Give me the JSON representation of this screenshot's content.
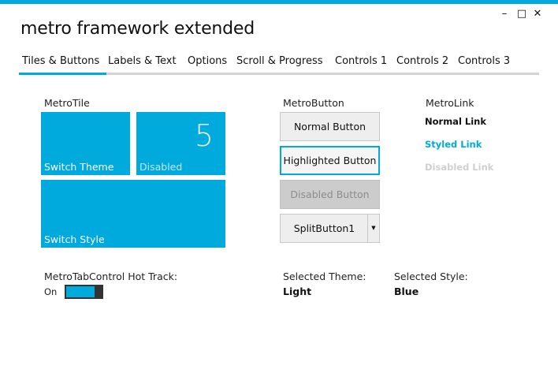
{
  "app": {
    "title": "metro framework extended"
  },
  "window_controls": {
    "minimize": "–",
    "maximize": "□",
    "close": "✕"
  },
  "tabs": [
    {
      "label": "Tiles & Buttons",
      "active": true
    },
    {
      "label": "Labels & Text"
    },
    {
      "label": "Options"
    },
    {
      "label": "Scroll & Progress"
    },
    {
      "label": "Controls 1"
    },
    {
      "label": "Controls 2"
    },
    {
      "label": "Controls 3"
    }
  ],
  "tiles_section": {
    "label": "MetroTile",
    "tiles": [
      {
        "text": "Switch Theme"
      },
      {
        "text": "Disabled",
        "count": "5"
      },
      {
        "text": "Switch Style"
      }
    ]
  },
  "buttons_section": {
    "label": "MetroButton",
    "normal": "Normal Button",
    "highlighted": "Highlighted Button",
    "disabled": "Disabled Button",
    "split": "SplitButton1"
  },
  "links_section": {
    "label": "MetroLink",
    "normal": "Normal Link",
    "styled": "Styled Link",
    "disabled": "Disabled Link"
  },
  "hot_track": {
    "label": "MetroTabControl Hot Track:",
    "state": "On",
    "checked": true
  },
  "selected_theme": {
    "label": "Selected Theme:",
    "value": "Light"
  },
  "selected_style": {
    "label": "Selected Style:",
    "value": "Blue"
  },
  "colors": {
    "accent": "#00aadd",
    "link_styled": "#00aadd",
    "link_disabled": "#d0d0d0"
  }
}
